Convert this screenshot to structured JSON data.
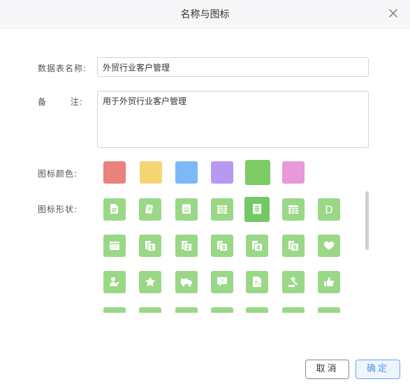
{
  "dialog": {
    "title": "名称与图标"
  },
  "form": {
    "name_label": "数据表名称:",
    "name_value": "外贸行业客户管理",
    "note_label": "备       注:",
    "note_value": "用于外贸行业客户管理",
    "color_label": "图标颜色:",
    "shape_label": "图标形状:"
  },
  "colors": [
    "#e9827c",
    "#f5d572",
    "#7fb8f8",
    "#b899f1",
    "#7dcc65",
    "#e899d9"
  ],
  "selected_color_index": 4,
  "icons": [
    "document-icon",
    "receipt-icon",
    "notepad-icon",
    "spreadsheet-icon",
    "list-document-icon",
    "table-icon",
    "letter-d-icon",
    "calendar-grid-icon",
    "number-1-icon",
    "number-2-icon",
    "number-3-icon",
    "number-4-icon",
    "number-5-icon",
    "heart-icon",
    "user-edit-icon",
    "star-icon",
    "truck-icon",
    "question-bubble-icon",
    "contract-icon",
    "auction-hammer-icon",
    "thumbs-up-icon"
  ],
  "selected_icon_index": 4,
  "buttons": {
    "cancel": "取消",
    "ok": "确定"
  }
}
